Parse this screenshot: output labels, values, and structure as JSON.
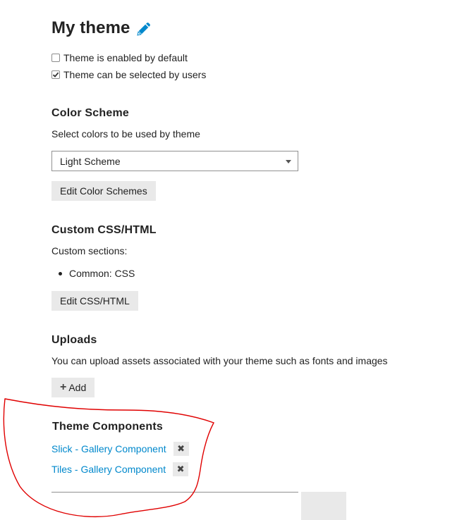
{
  "page": {
    "title": "My theme",
    "title_icon": "pencil-icon",
    "accent_color": "#0088cc"
  },
  "checkboxes": [
    {
      "label": "Theme is enabled by default",
      "checked": false
    },
    {
      "label": "Theme can be selected by users",
      "checked": true
    }
  ],
  "color_scheme": {
    "heading": "Color Scheme",
    "description": "Select colors to be used by theme",
    "selected": "Light Scheme",
    "edit_button": "Edit Color Schemes"
  },
  "custom_css": {
    "heading": "Custom CSS/HTML",
    "description": "Custom sections:",
    "sections": [
      "Common: CSS"
    ],
    "edit_button": "Edit CSS/HTML"
  },
  "uploads": {
    "heading": "Uploads",
    "description": "You can upload assets associated with your theme such as fonts and images",
    "add_button": "Add"
  },
  "theme_components": {
    "heading": "Theme Components",
    "items": [
      {
        "name": "Slick - Gallery Component",
        "remove_icon": "close-icon"
      },
      {
        "name": "Tiles - Gallery Component",
        "remove_icon": "close-icon"
      }
    ]
  },
  "annotation": {
    "color": "#e00000"
  }
}
